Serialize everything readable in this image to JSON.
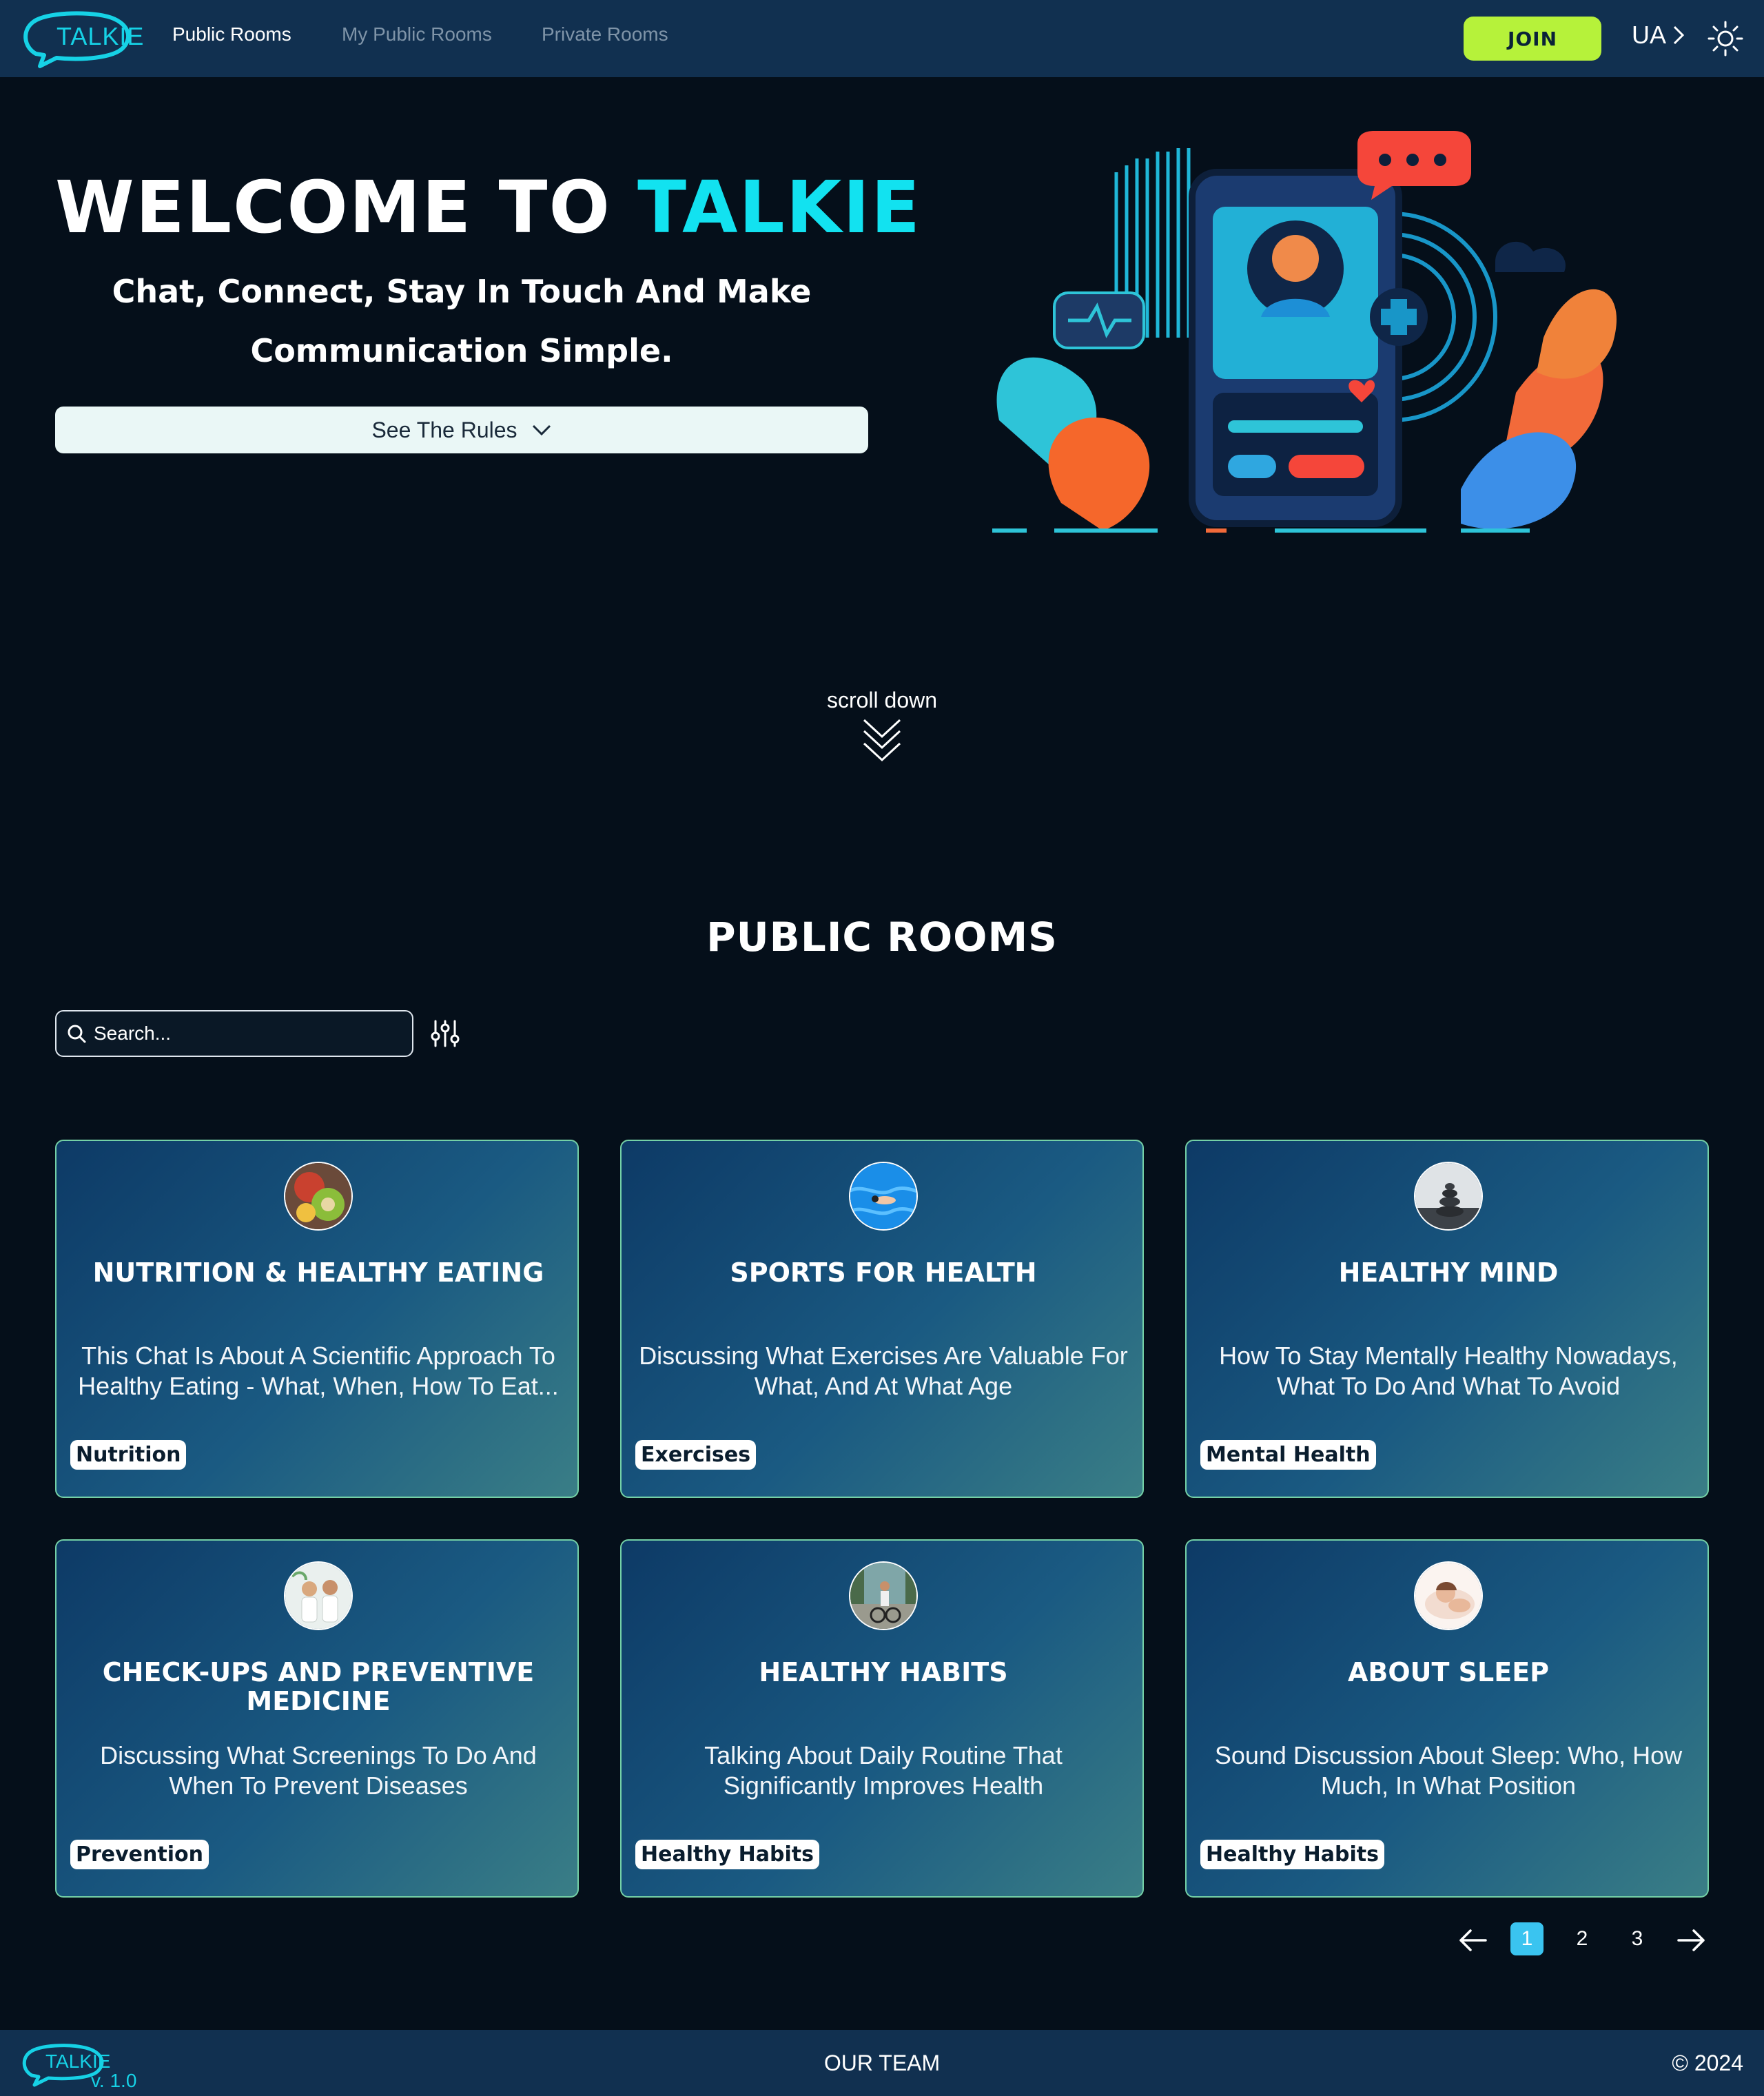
{
  "header": {
    "logo_text": "TALKIE",
    "nav": [
      "Public Rooms",
      "My Public Rooms",
      "Private Rooms"
    ],
    "join_label": "JOIN",
    "lang_label": "UA",
    "theme_icon": "sun-icon"
  },
  "hero": {
    "title_prefix": "WELCOME TO",
    "title_brand": "TALKIE",
    "subtitle": "Chat, Connect, Stay In Touch And Make Communication Simple.",
    "rules_label": "See The Rules",
    "scroll_label": "scroll down"
  },
  "rooms": {
    "section_title": "PUBLIC ROOMS",
    "search_placeholder": "Search...",
    "cards": [
      {
        "title": "NUTRITION & HEALTHY EATING",
        "desc": "This Chat Is About A Scientific Approach To Healthy Eating - What, When, How To Eat...",
        "tag": "Nutrition",
        "avatar": "food-bowl"
      },
      {
        "title": "SPORTS FOR HEALTH",
        "desc": "Discussing What Exercises Are Valuable For What, And At What Age",
        "tag": "Exercises",
        "avatar": "swimmer"
      },
      {
        "title": "HEALTHY MIND",
        "desc": "How To Stay Mentally Healthy Nowadays, What To Do And What To Avoid",
        "tag": "Mental Health",
        "avatar": "stones"
      },
      {
        "title": "CHECK-UPS AND PREVENTIVE MEDICINE",
        "desc": "Discussing What Screenings To Do And When To Prevent Diseases",
        "tag": "Prevention",
        "avatar": "doctors"
      },
      {
        "title": "HEALTHY HABITS",
        "desc": "Talking About Daily Routine That Significantly Improves Health",
        "tag": "Healthy Habits",
        "avatar": "cyclist"
      },
      {
        "title": "ABOUT SLEEP",
        "desc": "Sound Discussion About Sleep: Who, How Much, In What Position",
        "tag": "Healthy Habits",
        "avatar": "sleeping-person"
      }
    ]
  },
  "pagination": {
    "pages": [
      "1",
      "2",
      "3"
    ],
    "current": "1"
  },
  "footer": {
    "logo_text": "TALKIE",
    "version": "v. 1.0",
    "team_label": "OUR TEAM",
    "copyright": "© 2024"
  },
  "colors": {
    "accent": "#12e2f0",
    "join_bg": "#b6f23a",
    "header_bg": "#113050",
    "page_bg": "#050f1a",
    "card_border": "#74d0a6"
  }
}
